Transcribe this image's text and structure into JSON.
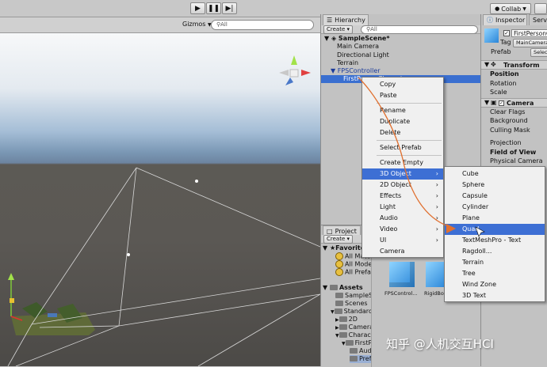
{
  "toolbar": {
    "play_icon": "play-icon",
    "pause_icon": "pause-icon",
    "step_icon": "step-icon",
    "collab_label": "Collab"
  },
  "scene": {
    "gizmos_label": "Gizmos",
    "search_placeholder": "All"
  },
  "hierarchy": {
    "tab_label": "Hierarchy",
    "create_label": "Create",
    "search_placeholder": "All",
    "items": [
      {
        "label": "SampleScene*"
      },
      {
        "label": "Main Camera"
      },
      {
        "label": "Directional Light"
      },
      {
        "label": "Terrain"
      },
      {
        "label": "FPSController"
      },
      {
        "label": "FirstPersonCharacter"
      }
    ]
  },
  "context_menu": {
    "items": [
      {
        "label": "Copy"
      },
      {
        "label": "Paste"
      },
      {
        "label": "Rename"
      },
      {
        "label": "Duplicate"
      },
      {
        "label": "Delete"
      },
      {
        "label": "Select Prefab"
      },
      {
        "label": "Create Empty"
      },
      {
        "label": "3D Object"
      },
      {
        "label": "2D Object"
      },
      {
        "label": "Effects"
      },
      {
        "label": "Light"
      },
      {
        "label": "Audio"
      },
      {
        "label": "Video"
      },
      {
        "label": "UI"
      },
      {
        "label": "Camera"
      }
    ]
  },
  "submenu": {
    "items": [
      {
        "label": "Cube"
      },
      {
        "label": "Sphere"
      },
      {
        "label": "Capsule"
      },
      {
        "label": "Cylinder"
      },
      {
        "label": "Plane"
      },
      {
        "label": "Quad"
      },
      {
        "label": "TextMeshPro - Text"
      },
      {
        "label": "Ragdoll..."
      },
      {
        "label": "Terrain"
      },
      {
        "label": "Tree"
      },
      {
        "label": "Wind Zone"
      },
      {
        "label": "3D Text"
      }
    ]
  },
  "project": {
    "tab_label": "Project",
    "create_label": "Create",
    "favorites_label": "Favorites",
    "favorites": [
      {
        "label": "All Materials"
      },
      {
        "label": "All Models"
      },
      {
        "label": "All Prefabs"
      }
    ],
    "assets_label": "Assets",
    "tree": [
      {
        "label": "SampleScenes"
      },
      {
        "label": "Scenes"
      },
      {
        "label": "Standard Assets"
      },
      {
        "label": "2D"
      },
      {
        "label": "Cameras"
      },
      {
        "label": "Characters"
      },
      {
        "label": "FirstPersonCharacter"
      },
      {
        "label": "Audio"
      },
      {
        "label": "Prefabs"
      }
    ],
    "assets": [
      {
        "label": "FPSControl..."
      },
      {
        "label": "RigidBod..."
      }
    ]
  },
  "inspector": {
    "tab_label": "Inspector",
    "second_tab_label": "Services",
    "object_name": "FirstPersonCharacter",
    "tag_label": "Tag",
    "tag_value": "MainCamera",
    "prefab_label": "Prefab",
    "prefab_button": "Select",
    "transform_label": "Transform",
    "transform_fields": [
      "Position",
      "Rotation",
      "Scale"
    ],
    "camera_label": "Camera",
    "camera_fields_a": [
      "Clear Flags",
      "Background",
      "Culling Mask"
    ],
    "camera_fields_b": [
      "Projection",
      "Field of View",
      "Physical Camera"
    ]
  },
  "watermark": "知乎 @人机交互HCI",
  "colors": {
    "menu_highlight": "#3d6fd4",
    "annotation_orange": "#e07030",
    "hierarchy_selected": "#3a6fd0"
  }
}
